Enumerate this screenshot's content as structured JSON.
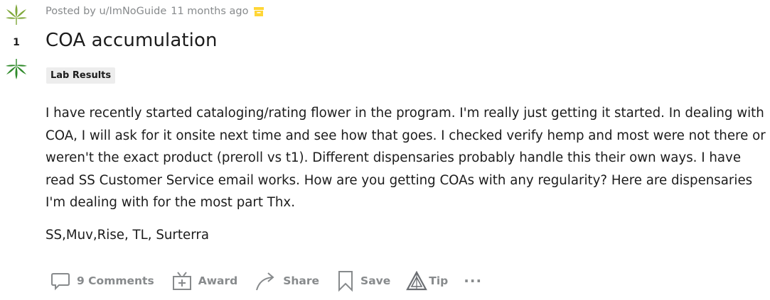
{
  "post": {
    "score": "1",
    "posted_by": "Posted by u/ImNoGuide",
    "time_ago": "11 months ago",
    "title": "COA accumulation",
    "flair": "Lab Results",
    "body_paragraph_1": "I have recently started cataloging/rating flower in the program. I'm really just getting it started. In dealing with COA, I will ask for it onsite next time and see how that goes. I checked verify hemp and most were not there or weren't the exact product (preroll vs t1). Different dispensaries probably handle this their own ways. I have read SS Customer Service email works. How are you getting COAs with any regularity? Here are dispensaries I'm dealing with for the most part Thx.",
    "body_paragraph_2": "SS,Muv,Rise, TL, Surterra"
  },
  "actions": {
    "comments": "9 Comments",
    "award": "Award",
    "share": "Share",
    "save": "Save",
    "tip": "Tip",
    "more": "···"
  },
  "icons": {
    "upvote": "cannabis-leaf-upvote-icon",
    "downvote": "cannabis-leaf-downvote-icon",
    "archived": "archive-icon",
    "comments": "comment-bubble-icon",
    "award": "gift-icon",
    "share": "share-arrow-icon",
    "save": "bookmark-icon",
    "tip": "tip-triangle-icon",
    "more": "more-dots-icon"
  },
  "colors": {
    "leaf_up": "#7fa83a",
    "leaf_down": "#2f8a2a",
    "archive": "#ffd635",
    "meta_text": "#878a8c",
    "flair_bg": "#ededed"
  }
}
